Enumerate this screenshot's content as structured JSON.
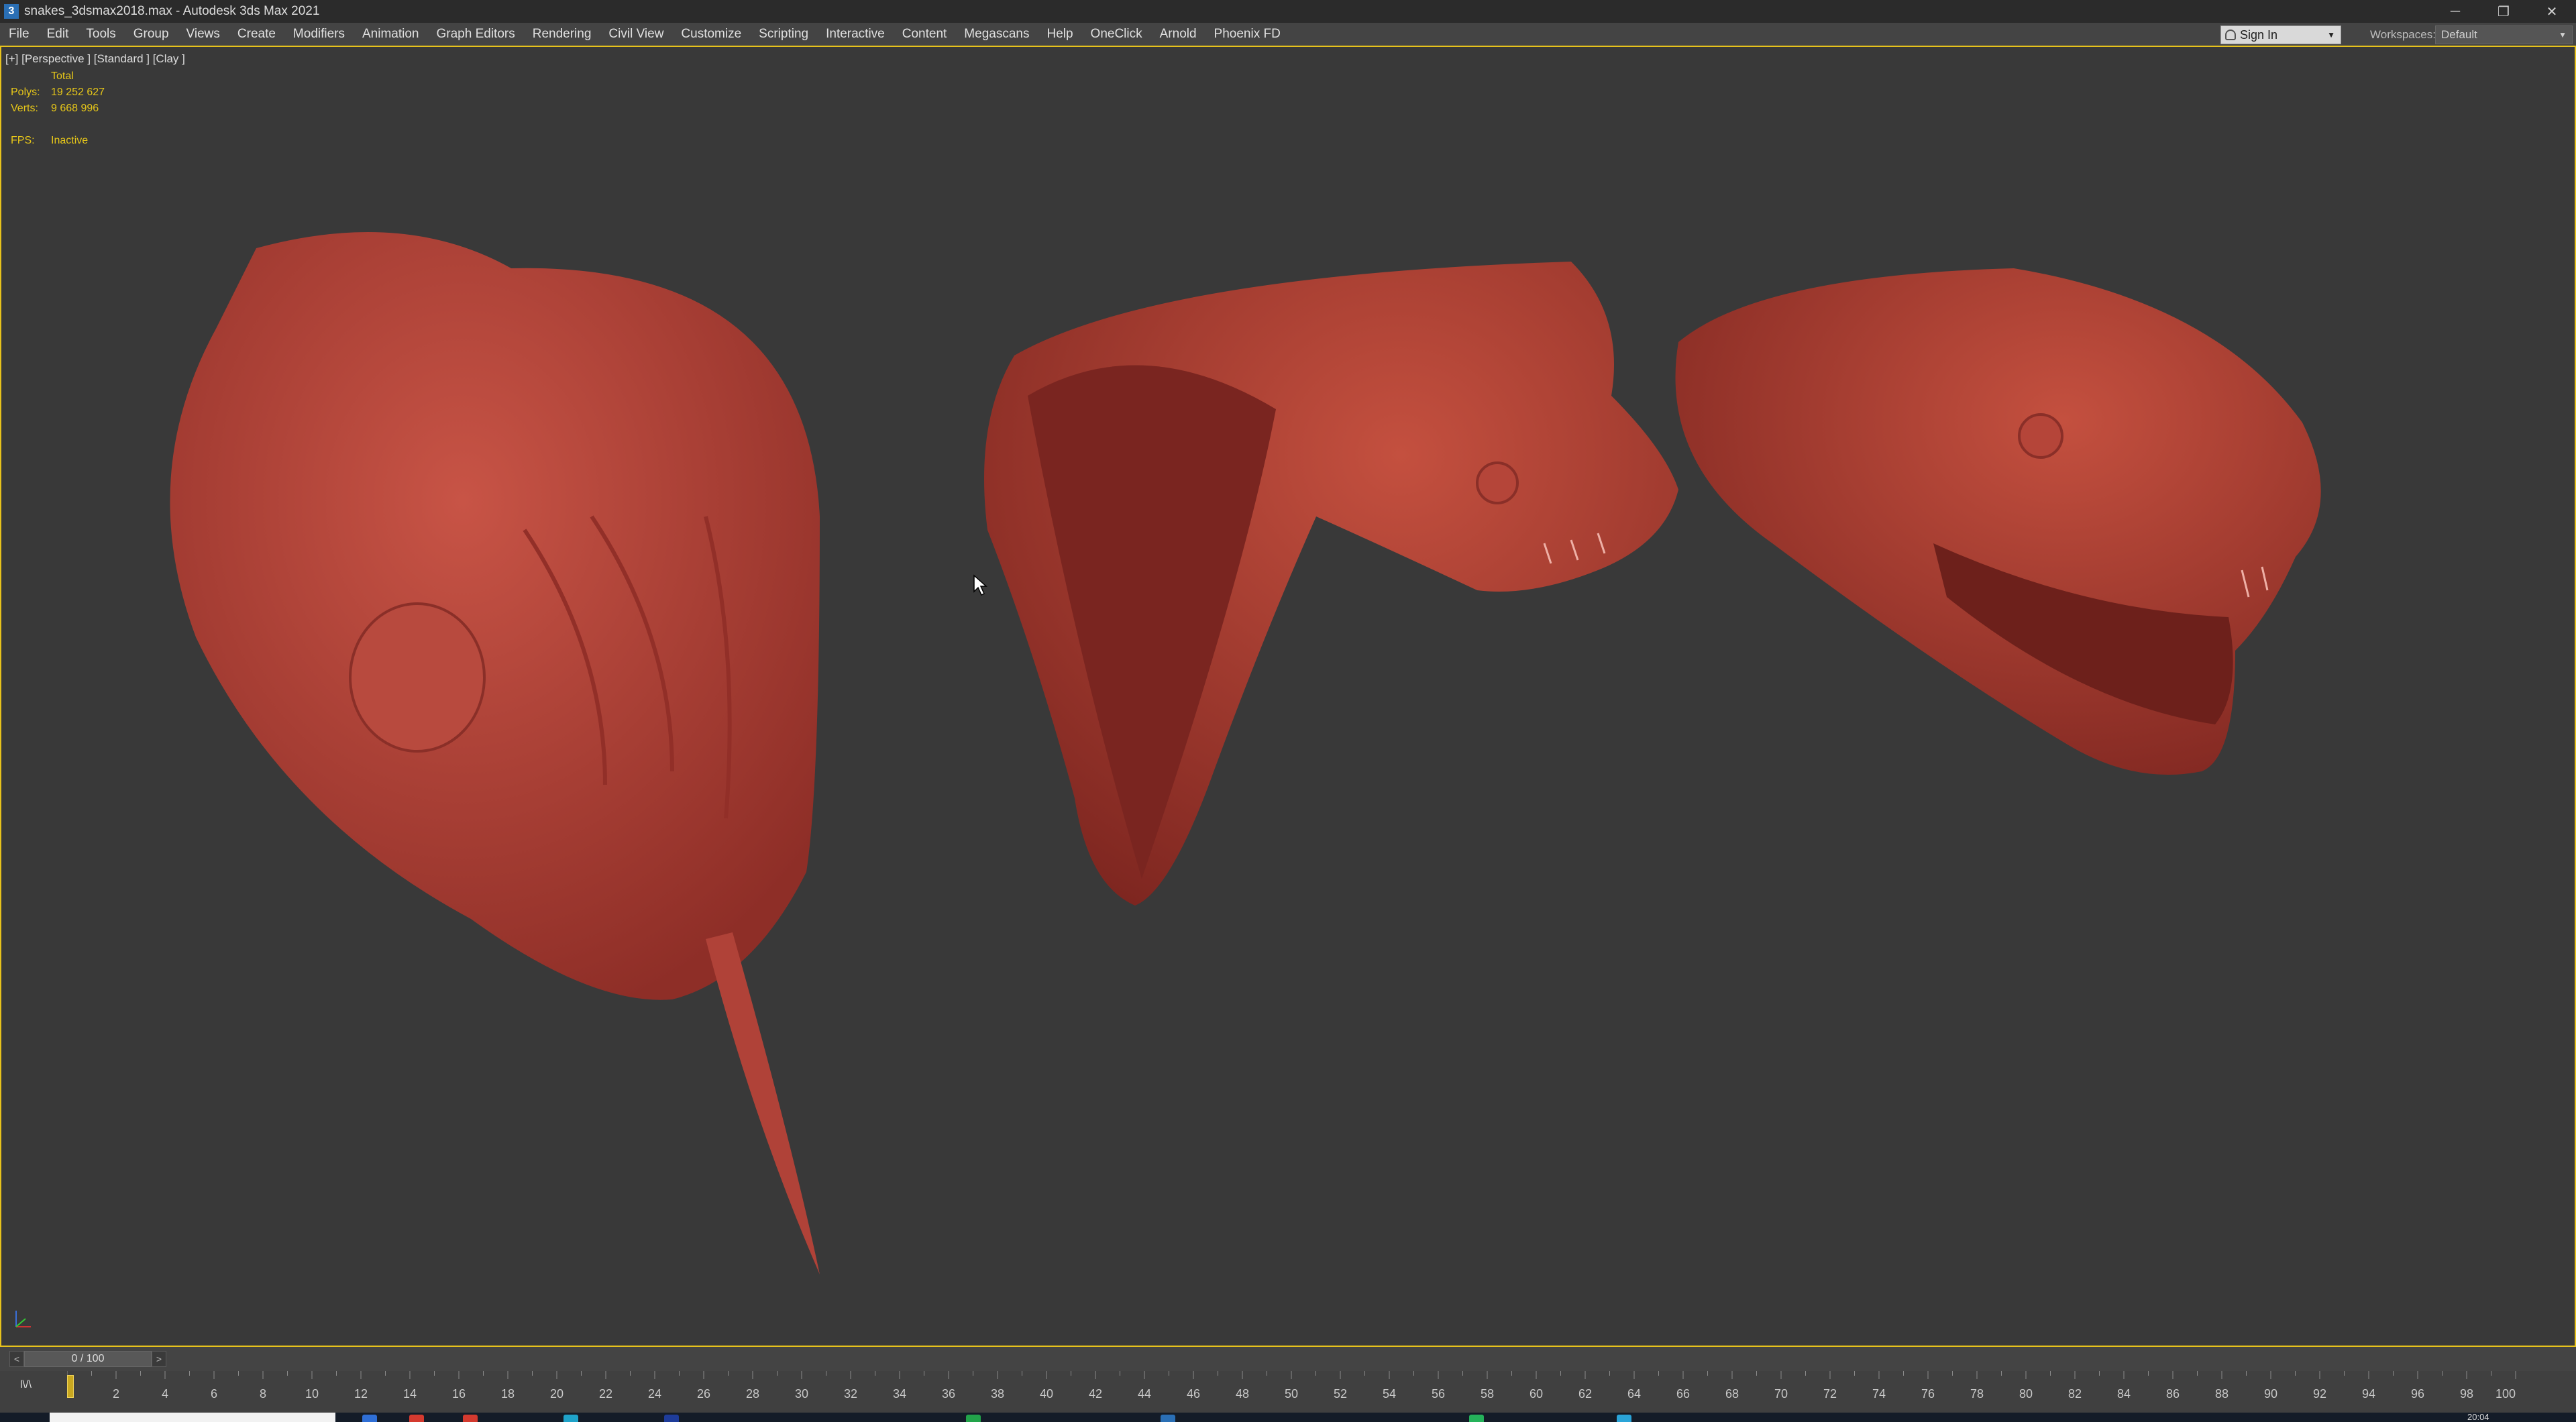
{
  "window": {
    "title": "snakes_3dsmax2018.max - Autodesk 3ds Max 2021",
    "app_icon": "3",
    "controls": {
      "minimize": "─",
      "restore": "❐",
      "close": "✕"
    }
  },
  "menu": [
    "File",
    "Edit",
    "Tools",
    "Group",
    "Views",
    "Create",
    "Modifiers",
    "Animation",
    "Graph Editors",
    "Rendering",
    "Civil View",
    "Customize",
    "Scripting",
    "Interactive",
    "Content",
    "Megascans",
    "Help",
    "OneClick",
    "Arnold",
    "Phoenix FD"
  ],
  "account": {
    "sign_in": "Sign In",
    "caret": "▼"
  },
  "workspaces": {
    "label": "Workspaces:",
    "value": "Default",
    "caret": "▼"
  },
  "viewport": {
    "label": "[+] [Perspective ] [Standard ] [Clay ]",
    "stats": {
      "header": "Total",
      "polys_label": "Polys:",
      "polys_value": "19 252 627",
      "verts_label": "Verts:",
      "verts_value": "9 668 996",
      "fps_label": "FPS:",
      "fps_value": "Inactive"
    },
    "model_color": "#b8443a",
    "accent_color": "#e6c619"
  },
  "timeslider": {
    "prev": "<",
    "next": ">",
    "frame": "0 / 100"
  },
  "timeline": {
    "key_icon": "l\\/\\",
    "ticks": [
      "2",
      "4",
      "6",
      "8",
      "10",
      "12",
      "14",
      "16",
      "18",
      "20",
      "22",
      "24",
      "26",
      "28",
      "30",
      "32",
      "34",
      "36",
      "38",
      "40",
      "42",
      "44",
      "46",
      "48",
      "50",
      "52",
      "54",
      "56",
      "58",
      "60",
      "62",
      "64",
      "66",
      "68",
      "70",
      "72",
      "74",
      "76",
      "78",
      "80",
      "82",
      "84",
      "86",
      "88",
      "90",
      "92",
      "94",
      "96",
      "98",
      "100"
    ]
  },
  "taskbar": {
    "clock": "20:04"
  }
}
